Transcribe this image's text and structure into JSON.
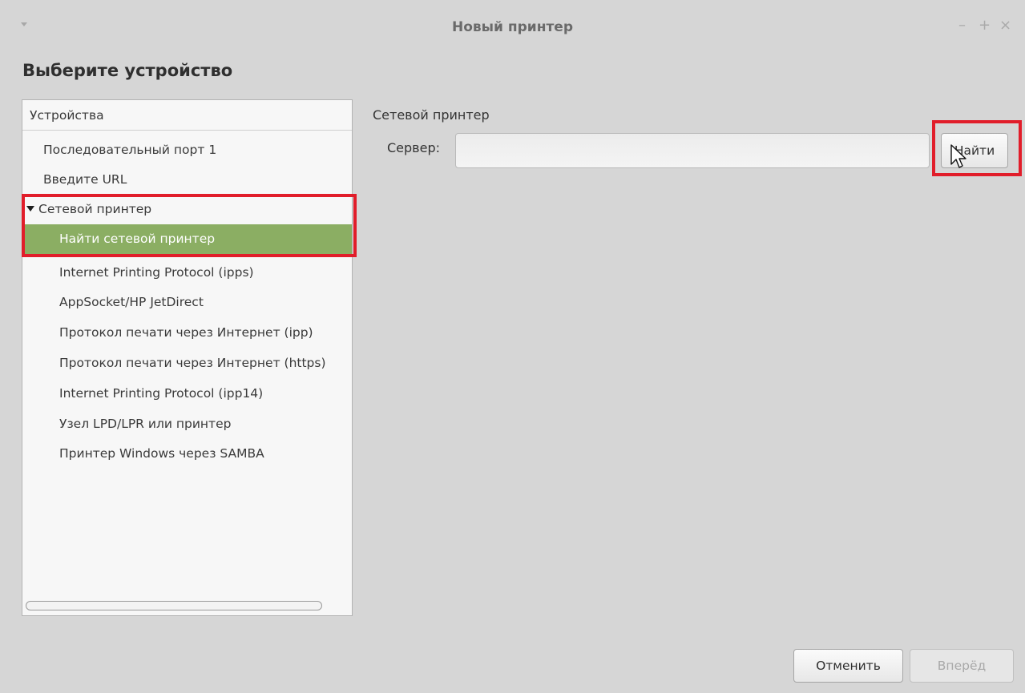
{
  "window": {
    "title": "Новый принтер",
    "controls": {
      "minimize": "–",
      "maximize": "+",
      "close": "×"
    }
  },
  "heading": "Выберите устройство",
  "devices": {
    "header": "Устройства",
    "items": [
      {
        "label": "Последовательный порт 1",
        "level": 1
      },
      {
        "label": "Введите URL",
        "level": 1
      },
      {
        "label": "Сетевой принтер",
        "level": 0,
        "expanded": true
      },
      {
        "label": "Найти сетевой принтер",
        "level": 2,
        "selected": true
      },
      {
        "label": "Internet Printing Protocol (ipps)",
        "level": 2
      },
      {
        "label": "AppSocket/HP JetDirect",
        "level": 2
      },
      {
        "label": "Протокол печати через Интернет (ipp)",
        "level": 2
      },
      {
        "label": "Протокол печати через Интернет (https)",
        "level": 2
      },
      {
        "label": "Internet Printing Protocol (ipp14)",
        "level": 2
      },
      {
        "label": "Узел LPD/LPR или принтер",
        "level": 2
      },
      {
        "label": "Принтер Windows через SAMBA",
        "level": 2
      }
    ]
  },
  "network": {
    "section_title": "Сетевой принтер",
    "server_label": "Сервер:",
    "server_value": "",
    "find_button": "Найти"
  },
  "footer": {
    "cancel": "Отменить",
    "next": "Вперёд"
  },
  "colors": {
    "highlight": "#e11d2a",
    "selection": "#8bae63"
  },
  "icons": {
    "window_menu": "chevron-down-icon",
    "cursor": "mouse-pointer-icon"
  }
}
